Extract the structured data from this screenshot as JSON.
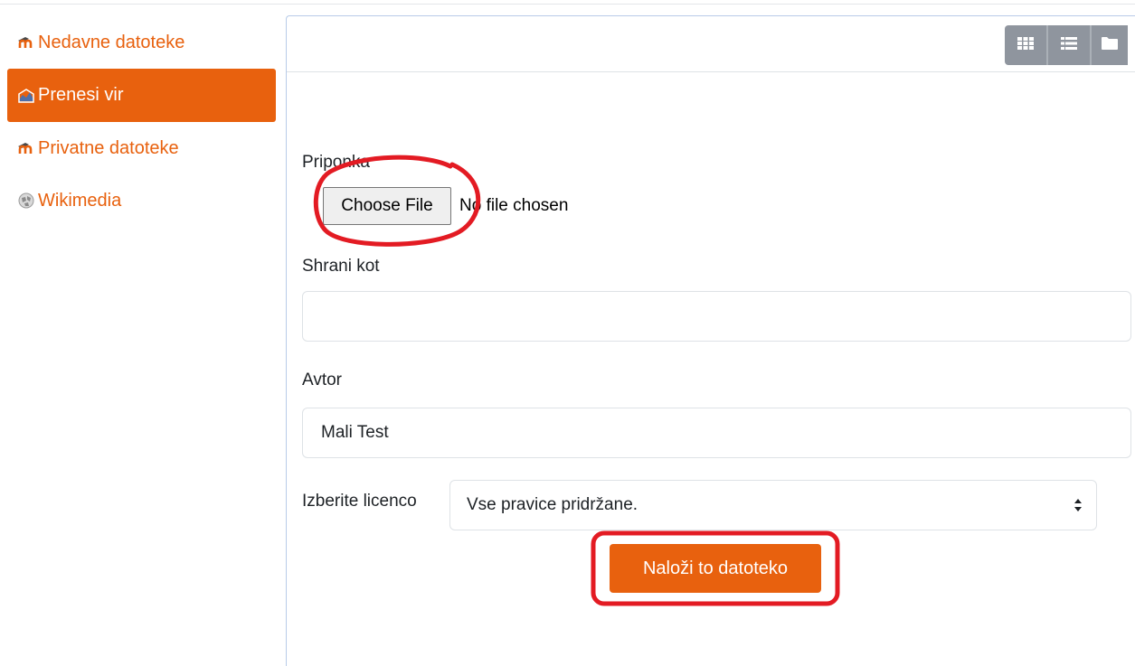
{
  "sidebar": {
    "items": [
      {
        "label": "Nedavne datoteke",
        "icon": "moodle-icon",
        "active": false
      },
      {
        "label": "Prenesi vir",
        "icon": "upload-icon",
        "active": true
      },
      {
        "label": "Privatne datoteke",
        "icon": "moodle-icon",
        "active": false
      },
      {
        "label": "Wikimedia",
        "icon": "wikimedia-icon",
        "active": false
      }
    ]
  },
  "viewbar": {
    "icons": [
      "grid-view-icon",
      "list-view-icon",
      "folder-view-icon"
    ]
  },
  "form": {
    "attachment_label": "Priponka",
    "choose_file_label": "Choose File",
    "no_file_text": "No file chosen",
    "save_as_label": "Shrani kot",
    "save_as_value": "",
    "author_label": "Avtor",
    "author_value": "Mali Test",
    "license_label": "Izberite licenco",
    "license_value": "Vse pravice pridržane.",
    "upload_button": "Naloži to datoteko"
  },
  "colors": {
    "accent": "#e8610e",
    "annotation": "#e31b23",
    "viewbar": "#8f959e"
  }
}
